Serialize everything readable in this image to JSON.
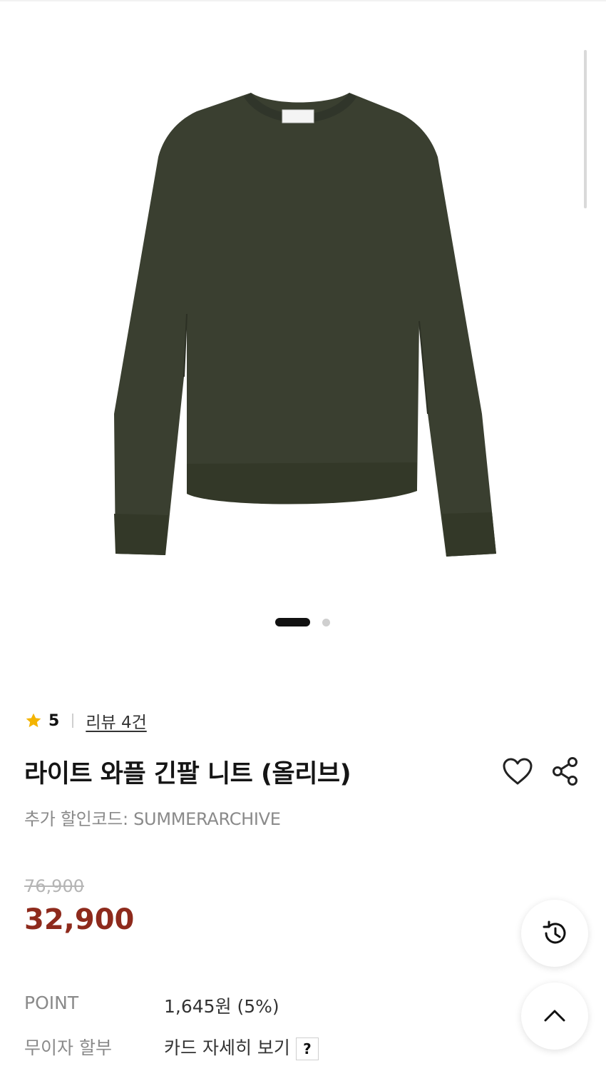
{
  "product": {
    "image_alt": "olive waffle knit sweater",
    "gallery": {
      "current": 1,
      "total": 2
    },
    "rating": {
      "score": "5",
      "review_link": "리뷰 4건"
    },
    "title": "라이트 와플 긴팔 니트 (올리브)",
    "coupon_text": "추가 할인코드: SUMMERARCHIVE",
    "original_price": "76,900",
    "sale_price": "32,900",
    "point": {
      "label": "POINT",
      "value": "1,645원 (5%)"
    },
    "installment": {
      "label": "무이자 할부",
      "value": "카드 자세히 보기",
      "help": "?"
    }
  },
  "icons": {
    "star": "star-icon",
    "wishlist": "heart-icon",
    "share": "share-icon",
    "recent": "history-icon",
    "top": "chevron-up-icon"
  },
  "colors": {
    "sale_price": "#8e2a1c",
    "star": "#f4b400",
    "sweater": "#3a3f30"
  }
}
